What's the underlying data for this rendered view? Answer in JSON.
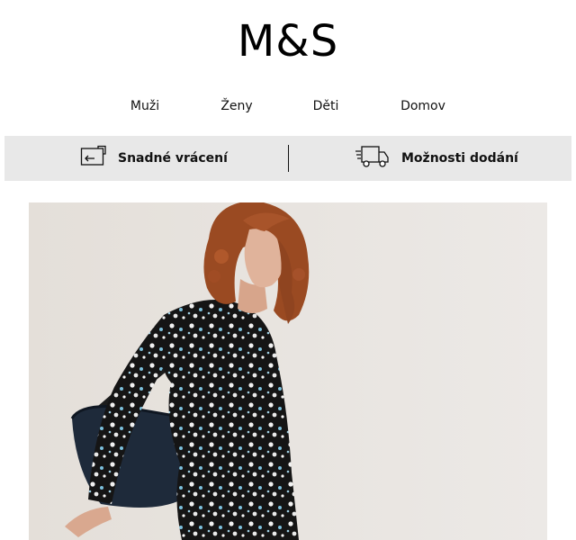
{
  "brand": {
    "logo_text": "M&S"
  },
  "nav": {
    "items": [
      {
        "label": "Muži"
      },
      {
        "label": "Ženy"
      },
      {
        "label": "Děti"
      },
      {
        "label": "Domov"
      }
    ]
  },
  "service_bar": {
    "returns": {
      "label": "Snadné vrácení",
      "icon": "return-box-icon"
    },
    "delivery": {
      "label": "Možnosti dodání",
      "icon": "delivery-truck-icon"
    }
  },
  "hero": {
    "image": "woman-in-floral-dress-with-shoulder-bag"
  },
  "colors": {
    "bar_background": "#e8e8e8",
    "hero_background": "#e6e2dd",
    "text": "#111111"
  }
}
